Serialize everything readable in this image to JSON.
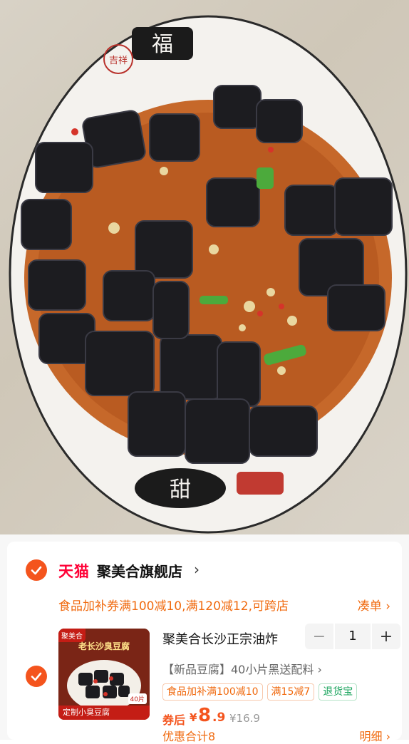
{
  "photo": {
    "alt": "",
    "bowl_char_top": "福",
    "bowl_char_bottom": "甜",
    "seal_text": "吉祥"
  },
  "store": {
    "platform": "天猫",
    "name": "聚美合旗舰店",
    "chevron": "›"
  },
  "promo": {
    "text": "食品加补券满100减10,满120减12,可跨店",
    "link": "凑单 ›"
  },
  "item": {
    "thumb": {
      "tag": "聚美合",
      "title": "老长沙臭豆腐",
      "bottom": "定制小臭豆腐",
      "badge": "40片"
    },
    "title": "聚美合长沙正宗油炸",
    "quantity": "1",
    "minus": "−",
    "plus": "+",
    "sku": "【新品豆腐】40小片黑送配料 ›",
    "tags": [
      "食品加补满100减10",
      "满15减7",
      "退货宝"
    ],
    "price": {
      "label": "券后",
      "currency": "¥",
      "int": "8",
      "dec": ".9",
      "original": "¥16.9"
    },
    "discount": "优惠合计8",
    "detail": "明细 ›"
  },
  "colors": {
    "accent": "#f4541d",
    "tmall": "#ff0036",
    "promo": "#f06a0f",
    "green": "#17a35b"
  }
}
